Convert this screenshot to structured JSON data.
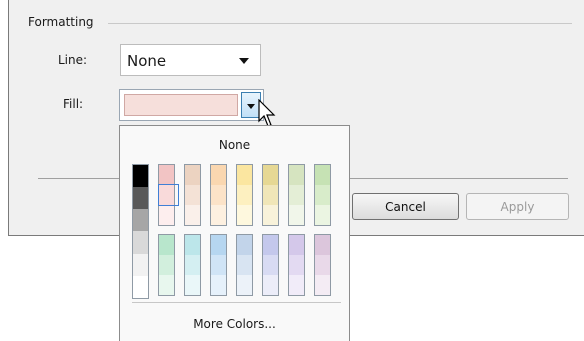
{
  "formatting": {
    "group_label": "Formatting",
    "line_label": "Line:",
    "line_value": "None",
    "fill_label": "Fill:",
    "fill_color": "#f6dfdb"
  },
  "palette": {
    "none_label": "None",
    "more_colors_label": "More Colors...",
    "gray_column": [
      "#000000",
      "#595959",
      "#a6a6a6",
      "#d9d9d9",
      "#f2f2f2",
      "#ffffff"
    ],
    "top_row_columns": [
      [
        "#f2c4c4",
        "#f9dada",
        "#fdeeee"
      ],
      [
        "#ecd3c1",
        "#f4e2d6",
        "#faf0ea"
      ],
      [
        "#fad7b0",
        "#fce3c8",
        "#fdf0e0"
      ],
      [
        "#fbe6a0",
        "#fdf0c0",
        "#fef8de"
      ],
      [
        "#e6d894",
        "#f0e6b8",
        "#f8f2da"
      ],
      [
        "#d6e4c0",
        "#e4eed6",
        "#f1f6ea"
      ],
      [
        "#c6e2b4",
        "#d8ecca",
        "#ebf5e2"
      ]
    ],
    "bottom_row_columns": [
      [
        "#b8e6cc",
        "#d2efdd",
        "#e8f7ee"
      ],
      [
        "#bce6ea",
        "#d4eff2",
        "#eaf7f9"
      ],
      [
        "#b6d6f0",
        "#d0e4f6",
        "#e6f1fb"
      ],
      [
        "#c2d4ea",
        "#d8e4f2",
        "#ecf2f9"
      ],
      [
        "#c4c8ec",
        "#d8dbf3",
        "#ecedf9"
      ],
      [
        "#d4c8ea",
        "#e3daf2",
        "#f1ecf9"
      ],
      [
        "#dcc6dc",
        "#e9d9e9",
        "#f4ecf4"
      ]
    ]
  },
  "buttons": {
    "cancel_label": "Cancel",
    "apply_label": "Apply"
  }
}
